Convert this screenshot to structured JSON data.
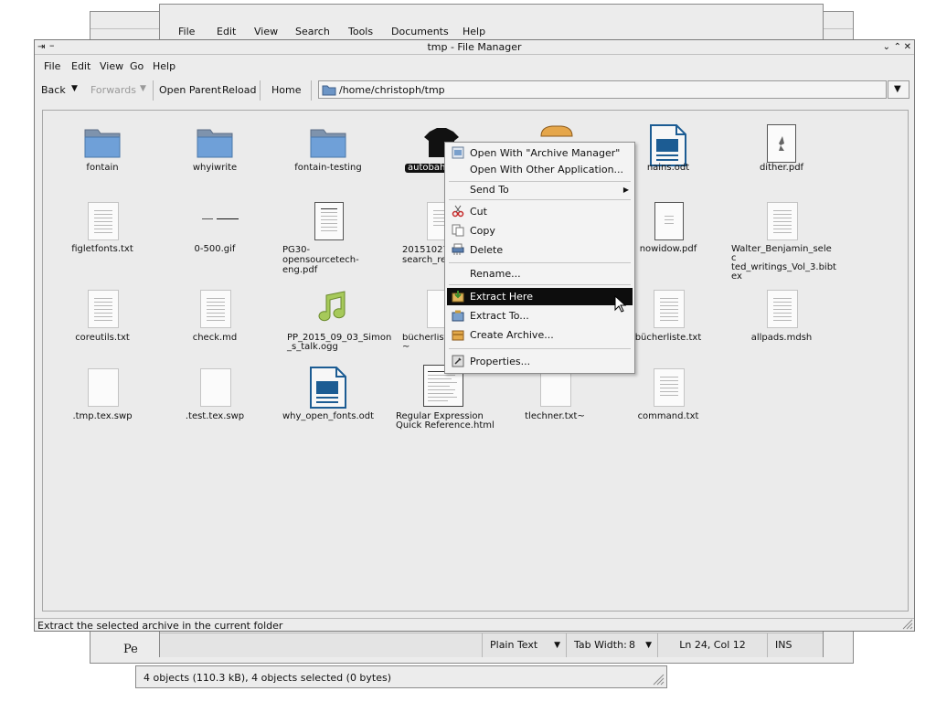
{
  "editor_window": {
    "menu": [
      "File",
      "Edit",
      "View",
      "Search",
      "Tools",
      "Documents",
      "Help"
    ],
    "status": {
      "mode": "Plain Text",
      "tab_width_label": "Tab Width:",
      "tab_width": "8",
      "position": "Ln 24, Col 12",
      "insert_mode": "INS"
    },
    "partial_text": "Pe"
  },
  "other_window": {
    "status": "4 objects (110.3 kB), 4 objects selected (0 bytes)"
  },
  "file_manager": {
    "title": "tmp - File Manager",
    "menu": [
      "File",
      "Edit",
      "View",
      "Go",
      "Help"
    ],
    "toolbar": {
      "back": "Back",
      "forwards": "Forwards",
      "open_parent": "Open Parent",
      "reload": "Reload",
      "home": "Home",
      "path": "/home/christoph/tmp"
    },
    "files": [
      {
        "label": "fontain",
        "icon": "folder-icon"
      },
      {
        "label": "whyiwrite",
        "icon": "folder-icon"
      },
      {
        "label": "fontain-testing",
        "icon": "folder-icon"
      },
      {
        "label": "autobahn",
        "icon": "archive-icon"
      },
      {
        "label": "",
        "icon": "archive-icon"
      },
      {
        "label": "nains.odt",
        "icon": "odt-icon"
      },
      {
        "label": "dither.pdf",
        "icon": "pdf-icon"
      },
      {
        "label": "figletfonts.txt",
        "icon": "text-file-icon"
      },
      {
        "label": "0-500.gif",
        "icon": "image-icon"
      },
      {
        "label": "PG30-opensourcetech-eng.pdf",
        "icon": "pdf-icon"
      },
      {
        "label": "20151027 search_re",
        "icon": "text-file-icon"
      },
      {
        "label": "",
        "icon": "text-file-icon"
      },
      {
        "label": "nowidow.pdf",
        "icon": "pdf-icon"
      },
      {
        "label": "Walter_Benjamin_selected_writings_Vol_3.bibtex",
        "icon": "text-file-icon"
      },
      {
        "label": "coreutils.txt",
        "icon": "text-file-icon"
      },
      {
        "label": "check.md",
        "icon": "text-file-icon"
      },
      {
        "label": "PP_2015_09_03_Simon_s_talk.ogg",
        "icon": "audio-icon"
      },
      {
        "label": "bücherliste_ ~",
        "icon": "text-file-icon"
      },
      {
        "label": "",
        "icon": "text-file-icon"
      },
      {
        "label": "bücherliste.txt",
        "icon": "text-file-icon"
      },
      {
        "label": "allpads.mdsh",
        "icon": "text-file-icon"
      },
      {
        "label": ".tmp.tex.swp",
        "icon": "blank-file-icon"
      },
      {
        "label": ".test.tex.swp",
        "icon": "blank-file-icon"
      },
      {
        "label": "why_open_fonts.odt",
        "icon": "odt-icon"
      },
      {
        "label": "Regular Expression Quick Reference.html",
        "icon": "html-icon"
      },
      {
        "label": "tlechner.txt~",
        "icon": "blank-file-icon"
      },
      {
        "label": "command.txt",
        "icon": "text-file-icon"
      }
    ],
    "context_menu": {
      "items": [
        "Open With \"Archive Manager\"",
        "Open With Other Application...",
        "Send To",
        "Cut",
        "Copy",
        "Delete",
        "Rename...",
        "Extract Here",
        "Extract To...",
        "Create Archive...",
        "Properties..."
      ],
      "selected": "Extract Here"
    },
    "statusbar": "Extract the selected archive in the current folder"
  }
}
